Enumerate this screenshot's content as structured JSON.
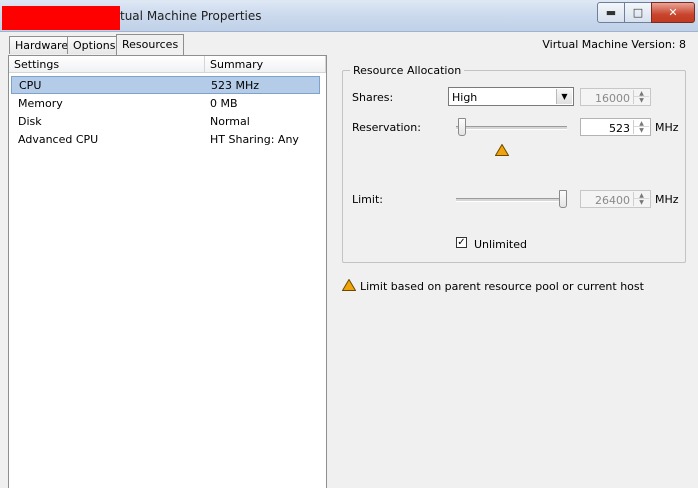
{
  "window": {
    "title": "tual Machine Properties",
    "controls": {
      "minimize": "▬",
      "maximize": "□",
      "close": "✕"
    }
  },
  "tabs": [
    {
      "label": "Hardware"
    },
    {
      "label": "Options"
    },
    {
      "label": "Resources"
    }
  ],
  "selected_tab": "Resources",
  "version_label": "Virtual Machine Version: 8",
  "list": {
    "columns": [
      "Settings",
      "Summary"
    ],
    "rows": [
      {
        "setting": "CPU",
        "summary": "523 MHz",
        "selected": true
      },
      {
        "setting": "Memory",
        "summary": "0 MB"
      },
      {
        "setting": "Disk",
        "summary": "Normal"
      },
      {
        "setting": "Advanced CPU",
        "summary": "HT Sharing: Any"
      }
    ]
  },
  "resource_allocation": {
    "title": "Resource Allocation",
    "shares": {
      "label": "Shares:",
      "selected": "High",
      "value": "16000"
    },
    "reservation": {
      "label": "Reservation:",
      "value": "523",
      "unit": "MHz",
      "slider_fraction": 0.02
    },
    "limit": {
      "label": "Limit:",
      "value": "26400",
      "unit": "MHz",
      "slider_fraction": 1.0
    },
    "unlimited": {
      "label": "Unlimited",
      "checked": true
    }
  },
  "note": "Limit based on parent resource pool or current host",
  "colors": {
    "warning": "#f0a30a",
    "selection": "#b5cce8",
    "close_button": "#c9452d"
  }
}
